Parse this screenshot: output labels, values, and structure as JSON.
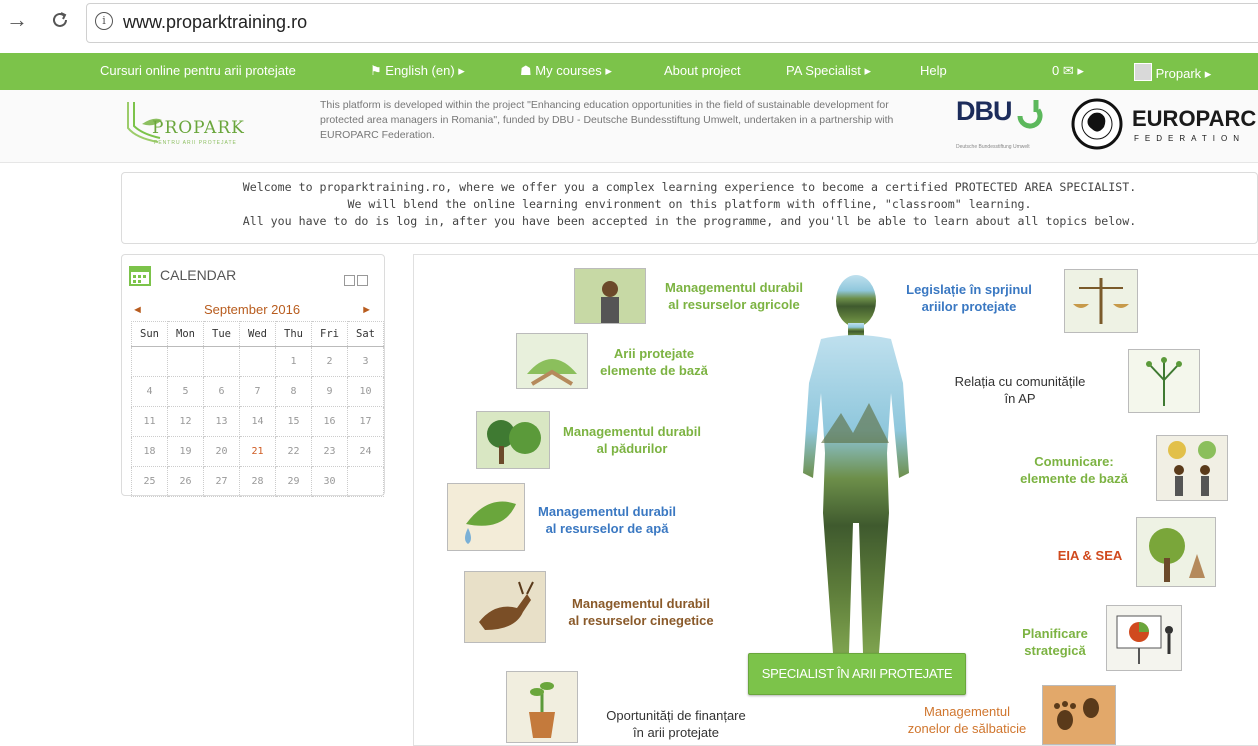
{
  "browser": {
    "url": "www.proparktraining.ro",
    "back_icon": "arrow-right-icon",
    "reload_icon": "reload-icon"
  },
  "nav": {
    "site_title": "Cursuri online pentru arii protejate",
    "language": "English (en) ▸",
    "my_courses": "My courses ▸",
    "about": "About project",
    "pa_specialist": "PA Specialist ▸",
    "help": "Help",
    "messages": "0 ✉ ▸",
    "user": "Propark ▸",
    "accent_color": "#7cc34a"
  },
  "banner": {
    "logo_text": "PROPARK",
    "logo_subtext": "PENTRU ARII PROTEJATE",
    "description": "This platform is developed within the project \"Enhancing education opportunities in the field of sustainable development for protected area managers in Romania\", funded by DBU - Deutsche Bundesstiftung Umwelt, undertaken in a partnership with EUROPARC Federation.",
    "dbu_text": "DBU",
    "dbu_sub": "Deutsche Bundesstiftung Umwelt",
    "europarc_text": "EUROPARC",
    "europarc_sub": "FEDERATION"
  },
  "welcome": {
    "line1": "Welcome to proparktraining.ro, where we offer you a complex learning experience to become a certified PROTECTED AREA SPECIALIST.",
    "line2": "We will blend the online learning environment on this platform with offline, \"classroom\" learning.",
    "line3": "All you have to do is log in, after you have been accepted in the programme, and you'll be able to learn about all topics below."
  },
  "calendar": {
    "title": "CALENDAR",
    "month": "September 2016",
    "prev": "◄",
    "next": "►",
    "weekdays": [
      "Sun",
      "Mon",
      "Tue",
      "Wed",
      "Thu",
      "Fri",
      "Sat"
    ],
    "weeks": [
      [
        "",
        "",
        "",
        "",
        "1",
        "2",
        "3"
      ],
      [
        "4",
        "5",
        "6",
        "7",
        "8",
        "9",
        "10"
      ],
      [
        "11",
        "12",
        "13",
        "14",
        "15",
        "16",
        "17"
      ],
      [
        "18",
        "19",
        "20",
        "21",
        "22",
        "23",
        "24"
      ],
      [
        "25",
        "26",
        "27",
        "28",
        "29",
        "30",
        ""
      ]
    ],
    "today": "21"
  },
  "topics": {
    "t1": "Managementul durabil\nal resurselor agricole",
    "t2": "Arii protejate\nelemente de bază",
    "t3": "Managementul durabil\nal pădurilor",
    "t4": "Managementul durabil\nal resurselor de apă",
    "t5": "Managementul durabil\nal resurselor cinegetice",
    "t6": "Oportunități de finanțare\nîn arii protejate",
    "t7": "Legislație în sprjinul\nariilor protejate",
    "t8": "Relația cu comunitățile\nîn AP",
    "t9": "Comunicare:\nelemente de bază",
    "t10": "EIA & SEA",
    "t11": "Planificare\nstrategică",
    "t12": "Managementul\nzonelor de sălbaticie"
  },
  "specialist_button": "SPECIALIST ÎN ARII PROTEJATE"
}
